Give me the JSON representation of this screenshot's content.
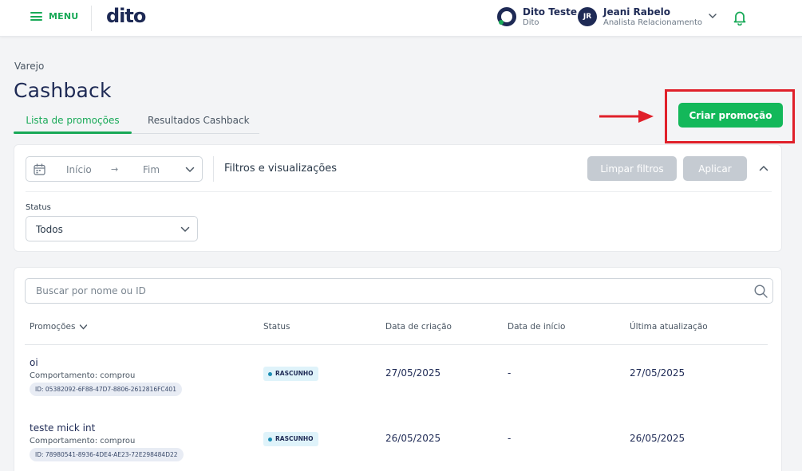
{
  "header": {
    "menu_label": "MENU",
    "logo_text": "dito",
    "org": {
      "name": "Dito Teste",
      "sub": "Dito"
    },
    "user": {
      "initials": "JR",
      "name": "Jeani Rabelo",
      "role": "Analista Relacionamento"
    }
  },
  "page": {
    "breadcrumb": "Varejo",
    "title": "Cashback",
    "tabs": [
      {
        "label": "Lista de promoções",
        "active": true
      },
      {
        "label": "Resultados Cashback",
        "active": false
      }
    ],
    "create_button": "Criar promoção"
  },
  "filters": {
    "date_start": "Início",
    "date_arrow": "→",
    "date_end": "Fim",
    "title": "Filtros e visualizações",
    "clear_button": "Limpar filtros",
    "apply_button": "Aplicar",
    "status_label": "Status",
    "status_value": "Todos"
  },
  "list": {
    "search_placeholder": "Buscar por nome ou ID",
    "columns": [
      "Promoções",
      "Status",
      "Data de criação",
      "Data de início",
      "Última atualização"
    ],
    "rows": [
      {
        "name": "oi",
        "behavior": "Comportamento: comprou",
        "id": "ID: 05382092-6F88-47D7-8806-2612816FC401",
        "status": "RASCUNHO",
        "created": "27/05/2025",
        "start": "-",
        "updated": "27/05/2025"
      },
      {
        "name": "teste mick int",
        "behavior": "Comportamento: comprou",
        "id": "ID: 78980541-8936-4DE4-AE23-72E298484D22",
        "status": "RASCUNHO",
        "created": "26/05/2025",
        "start": "-",
        "updated": "26/05/2025"
      }
    ]
  },
  "colors": {
    "brand_green": "#13b85a",
    "navy": "#1e2a55",
    "annotation_red": "#e0202a",
    "disabled_button": "#c5cbd2",
    "badge_bg": "#dff3fa"
  },
  "icons": [
    "hamburger-icon",
    "chevron-down-icon",
    "bell-icon",
    "calendar-icon",
    "arrow-right-icon",
    "chevron-up-icon",
    "search-icon"
  ]
}
